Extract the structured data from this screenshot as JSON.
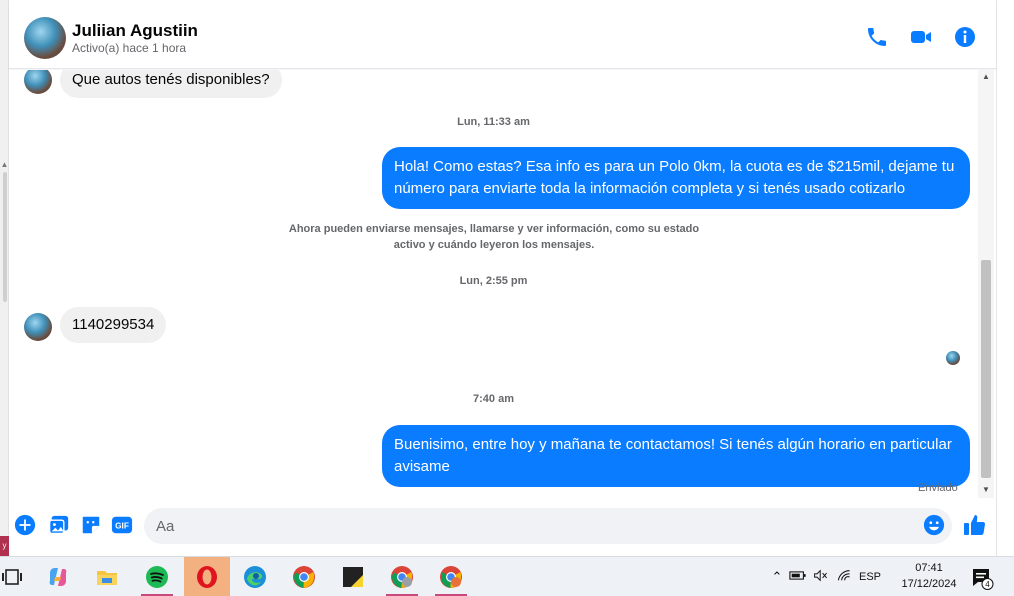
{
  "header": {
    "name": "Juliian Agustiin",
    "status": "Activo(a) hace 1 hora"
  },
  "messages": {
    "m1_text": "Que autos tenés disponibles?",
    "ts1": "Lun, 11:33 am",
    "m2_text": "Hola! Como estas? Esa info es para un Polo 0km, la cuota es de $215mil, dejame tu número para enviarte toda la información completa y si tenés usado cotizarlo",
    "notice": "Ahora pueden enviarse mensajes, llamarse y ver información, como su estado activo y cuándo leyeron los mensajes.",
    "ts2": "Lun, 2:55 pm",
    "m3_text": "1140299534",
    "ts3": "7:40 am",
    "m4_text": "Buenisimo, entre hoy y mañana te contactamos! Si tenés algún horario en particular avisame",
    "sent_label": "Enviado"
  },
  "composer": {
    "placeholder": "Aa",
    "gif_label": "GIF"
  },
  "taskbar": {
    "lang": "ESP",
    "time": "07:41",
    "date": "17/12/2024",
    "notif_count": "4"
  },
  "colors": {
    "accent": "#0a7cff",
    "incoming_bubble": "#f0f0f0"
  }
}
